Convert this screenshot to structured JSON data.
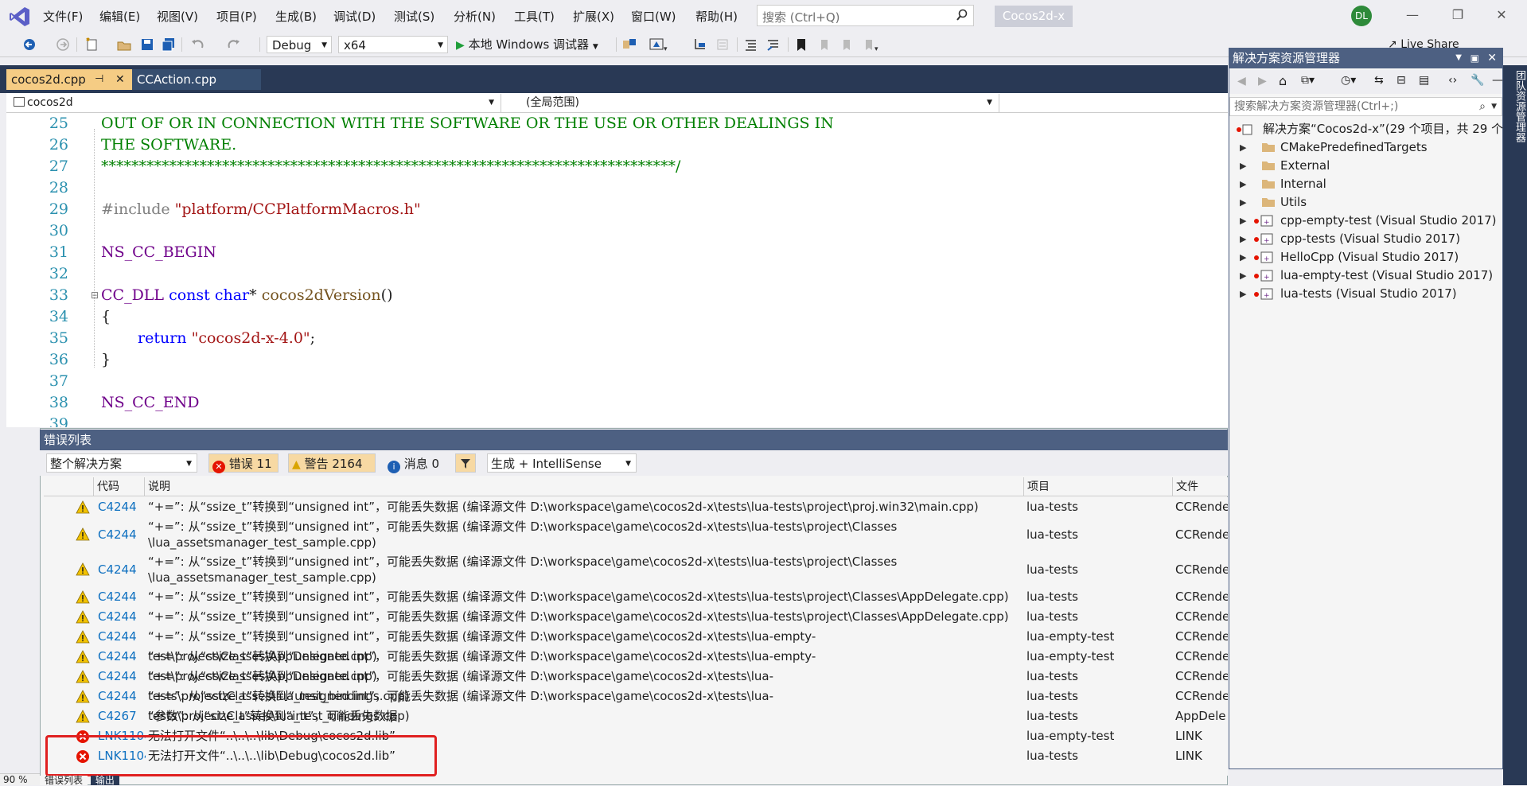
{
  "app": {
    "title": "Cocos2d-x",
    "avatar": "DL",
    "search_placeholder": "搜索 (Ctrl+Q)"
  },
  "menu": [
    "文件(F)",
    "编辑(E)",
    "视图(V)",
    "项目(P)",
    "生成(B)",
    "调试(D)",
    "测试(S)",
    "分析(N)",
    "工具(T)",
    "扩展(X)",
    "窗口(W)",
    "帮助(H)"
  ],
  "toolbar": {
    "config": "Debug",
    "platform": "x64",
    "run_label": "本地 Windows 调试器",
    "live_share": "Live Share"
  },
  "editor": {
    "tabs": [
      {
        "label": "cocos2d.cpp",
        "active": true
      },
      {
        "label": "CCAction.cpp",
        "active": false
      }
    ],
    "nav_scope": "cocos2d",
    "nav_member": "(全局范围)",
    "zoom": "90 %",
    "lines": [
      {
        "num": "25",
        "text": "OUT OF OR IN CONNECTION WITH THE SOFTWARE OR THE USE OR OTHER DEALINGS IN"
      },
      {
        "num": "26",
        "text": "THE SOFTWARE."
      },
      {
        "num": "27",
        "text": "****************************************************************************/"
      },
      {
        "num": "28",
        "text": ""
      },
      {
        "num": "29",
        "pp": "#include ",
        "str": "\"platform/CCPlatformMacros.h\""
      },
      {
        "num": "30",
        "text": ""
      },
      {
        "num": "31",
        "mac": "NS_CC_BEGIN"
      },
      {
        "num": "32",
        "text": ""
      },
      {
        "num": "33",
        "mac": "CC_DLL",
        "kw1": "const",
        "kw2": "char",
        "rest": "* ",
        "fn": "cocos2dVersion",
        "tail": "()"
      },
      {
        "num": "34",
        "text": "{"
      },
      {
        "num": "35",
        "kw": "return",
        "str": "\"cocos2d-x-4.0\"",
        "tail": ";"
      },
      {
        "num": "36",
        "text": "}"
      },
      {
        "num": "37",
        "text": ""
      },
      {
        "num": "38",
        "mac": "NS_CC_END"
      },
      {
        "num": "39",
        "text": ""
      }
    ]
  },
  "error_list": {
    "title": "错误列表",
    "scope": "整个解决方案",
    "errors_label": "错误 11",
    "warnings_label": "警告 2164",
    "messages_label": "消息 0",
    "source": "生成 + IntelliSense",
    "columns": [
      "代码",
      "说明",
      "项目",
      "文件"
    ],
    "rows": [
      {
        "type": "warning",
        "code": "C4244",
        "desc": "“+=”: 从“ssize_t”转换到“unsigned int”，可能丢失数据 (编译源文件 D:\\workspace\\game\\cocos2d-x\\tests\\lua-tests\\project\\proj.win32\\main.cpp)",
        "desc2": "",
        "project": "lua-tests",
        "file": "CCRende"
      },
      {
        "type": "warning",
        "code": "C4244",
        "desc": "“+=”: 从“ssize_t”转换到“unsigned int”，可能丢失数据 (编译源文件 D:\\workspace\\game\\cocos2d-x\\tests\\lua-tests\\project\\Classes",
        "desc2": "\\lua_assetsmanager_test_sample.cpp)",
        "project": "lua-tests",
        "file": "CCRende"
      },
      {
        "type": "warning",
        "code": "C4244",
        "desc": "“+=”: 从“ssize_t”转换到“unsigned int”，可能丢失数据 (编译源文件 D:\\workspace\\game\\cocos2d-x\\tests\\lua-tests\\project\\Classes",
        "desc2": "\\lua_assetsmanager_test_sample.cpp)",
        "project": "lua-tests",
        "file": "CCRende"
      },
      {
        "type": "warning",
        "code": "C4244",
        "desc": "“+=”: 从“ssize_t”转换到“unsigned int”，可能丢失数据 (编译源文件 D:\\workspace\\game\\cocos2d-x\\tests\\lua-tests\\project\\Classes\\AppDelegate.cpp)",
        "desc2": "",
        "project": "lua-tests",
        "file": "CCRende"
      },
      {
        "type": "warning",
        "code": "C4244",
        "desc": "“+=”: 从“ssize_t”转换到“unsigned int”，可能丢失数据 (编译源文件 D:\\workspace\\game\\cocos2d-x\\tests\\lua-tests\\project\\Classes\\AppDelegate.cpp)",
        "desc2": "",
        "project": "lua-tests",
        "file": "CCRende"
      },
      {
        "type": "warning",
        "code": "C4244",
        "desc": "“+=”: 从“ssize_t”转换到“unsigned int”，可能丢失数据 (编译源文件 D:\\workspace\\game\\cocos2d-x\\tests\\lua-empty-test\\project\\Classes\\AppDelegate.cpp)",
        "desc2": "",
        "project": "lua-empty-test",
        "file": "CCRende"
      },
      {
        "type": "warning",
        "code": "C4244",
        "desc": "“+=”: 从“ssize_t”转换到“unsigned int”，可能丢失数据 (编译源文件 D:\\workspace\\game\\cocos2d-x\\tests\\lua-empty-test\\project\\Classes\\AppDelegate.cpp)",
        "desc2": "",
        "project": "lua-empty-test",
        "file": "CCRende"
      },
      {
        "type": "warning",
        "code": "C4244",
        "desc": "“+=”: 从“ssize_t”转换到“unsigned int”，可能丢失数据 (编译源文件 D:\\workspace\\game\\cocos2d-x\\tests\\lua-tests\\project\\Classes\\lua_test_bindings.cpp)",
        "desc2": "",
        "project": "lua-tests",
        "file": "CCRende"
      },
      {
        "type": "warning",
        "code": "C4244",
        "desc": "“+=”: 从“ssize_t”转换到“unsigned int”，可能丢失数据 (编译源文件 D:\\workspace\\game\\cocos2d-x\\tests\\lua-tests\\project\\Classes\\lua_test_bindings.cpp)",
        "desc2": "",
        "project": "lua-tests",
        "file": "CCRende"
      },
      {
        "type": "warning",
        "code": "C4267",
        "desc": "“参数”: 从“size_t”转换到“int”，可能丢失数据",
        "desc2": "",
        "project": "lua-tests",
        "file": "AppDele"
      },
      {
        "type": "error",
        "code": "LNK1104",
        "desc": "无法打开文件“..\\..\\..\\lib\\Debug\\cocos2d.lib”",
        "desc2": "",
        "project": "lua-empty-test",
        "file": "LINK"
      },
      {
        "type": "error",
        "code": "LNK1104",
        "desc": "无法打开文件“..\\..\\..\\lib\\Debug\\cocos2d.lib”",
        "desc2": "",
        "project": "lua-tests",
        "file": "LINK"
      }
    ],
    "bottom_tabs": [
      "错误列表",
      "输出"
    ]
  },
  "solution_explorer": {
    "title": "解决方案资源管理器",
    "search_placeholder": "搜索解决方案资源管理器(Ctrl+;)",
    "root": "解决方案“Cocos2d-x”(29 个项目，共 29 个)",
    "items": [
      {
        "label": "CMakePredefinedTargets",
        "kind": "folder"
      },
      {
        "label": "External",
        "kind": "folder"
      },
      {
        "label": "Internal",
        "kind": "folder"
      },
      {
        "label": "Utils",
        "kind": "folder"
      },
      {
        "label": "cpp-empty-test (Visual Studio 2017)",
        "kind": "project"
      },
      {
        "label": "cpp-tests (Visual Studio 2017)",
        "kind": "project"
      },
      {
        "label": "HelloCpp (Visual Studio 2017)",
        "kind": "project"
      },
      {
        "label": "lua-empty-test (Visual Studio 2017)",
        "kind": "project"
      },
      {
        "label": "lua-tests (Visual Studio 2017)",
        "kind": "project"
      }
    ],
    "side_tab": "团队资源管理器"
  },
  "colors": {
    "accent": "#4d6082",
    "active_tab": "#f5cc84",
    "error": "#e51400",
    "warning": "#f2c200"
  }
}
